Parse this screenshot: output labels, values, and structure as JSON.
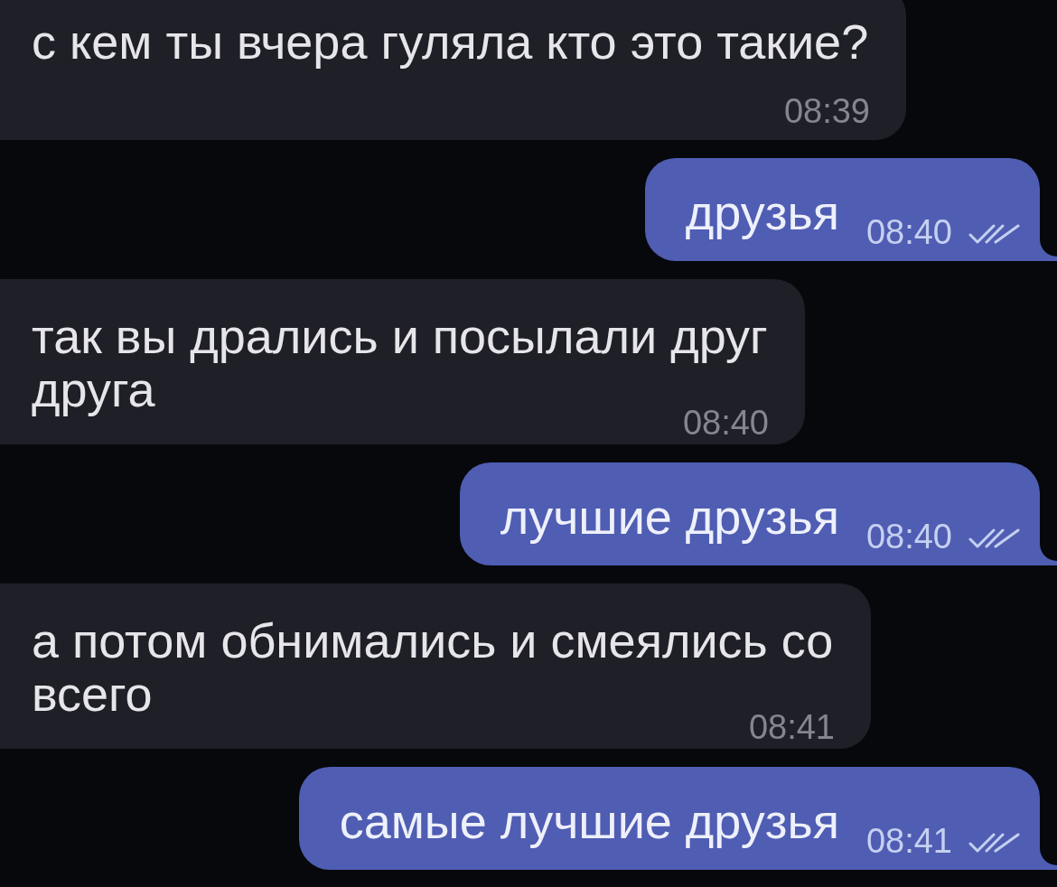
{
  "messages": [
    {
      "kind": "incoming",
      "text": "с кем ты вчера гуляла кто это такие?",
      "time": "08:39"
    },
    {
      "kind": "outgoing",
      "text": "друзья",
      "time": "08:40",
      "read": true
    },
    {
      "kind": "incoming",
      "text": "так вы дрались и посылали друг друга",
      "time": "08:40"
    },
    {
      "kind": "outgoing",
      "text": "лучшие друзья",
      "time": "08:40",
      "read": true
    },
    {
      "kind": "incoming",
      "text": "а потом обнимались и смеялись со всего",
      "time": "08:41"
    },
    {
      "kind": "outgoing",
      "text": "самые лучшие друзья",
      "time": "08:41",
      "read": true
    }
  ]
}
